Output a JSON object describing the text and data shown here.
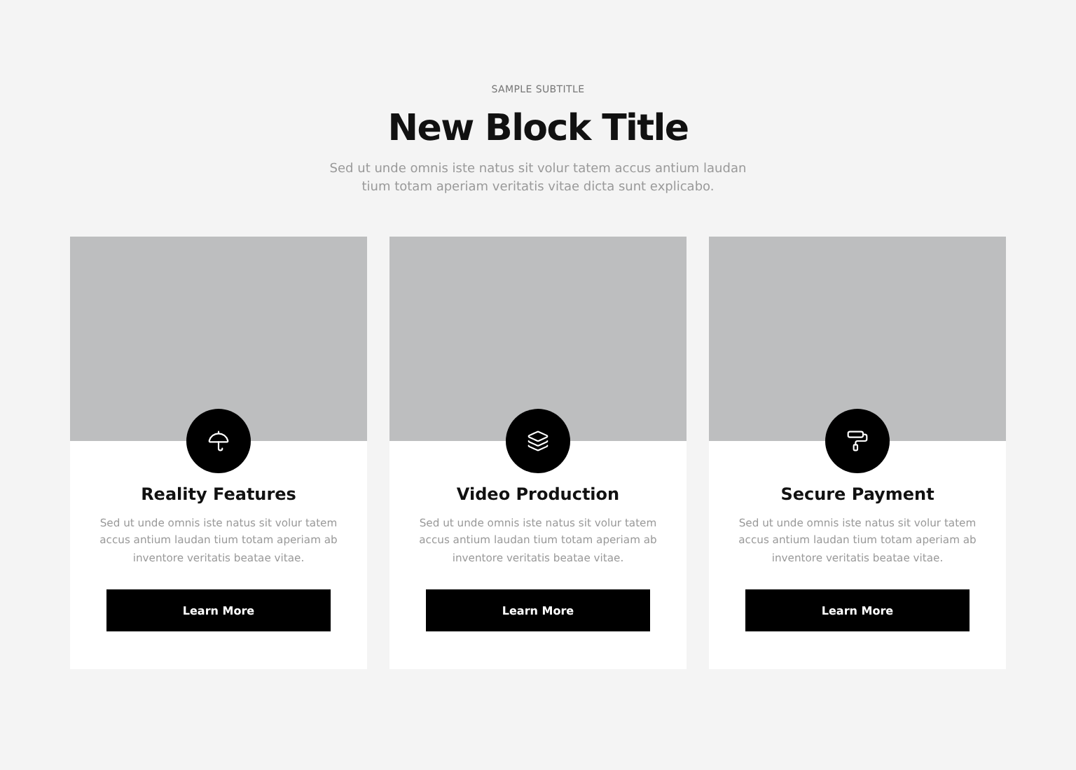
{
  "header": {
    "subtitle": "SAMPLE SUBTITLE",
    "title": "New Block Title",
    "description": "Sed ut unde omnis iste natus sit volur tatem accus antium laudan tium totam aperiam veritatis vitae dicta sunt explicabo."
  },
  "cards": [
    {
      "title": "Reality Features",
      "text": "Sed ut unde omnis iste natus sit volur tatem accus antium laudan tium totam aperiam ab inventore veritatis beatae vitae.",
      "button": "Learn More"
    },
    {
      "title": "Video Production",
      "text": "Sed ut unde omnis iste natus sit volur tatem accus antium laudan tium totam aperiam ab inventore veritatis beatae vitae.",
      "button": "Learn More"
    },
    {
      "title": "Secure Payment",
      "text": "Sed ut unde omnis iste natus sit volur tatem accus antium laudan tium totam aperiam ab inventore veritatis beatae vitae.",
      "button": "Learn More"
    }
  ]
}
